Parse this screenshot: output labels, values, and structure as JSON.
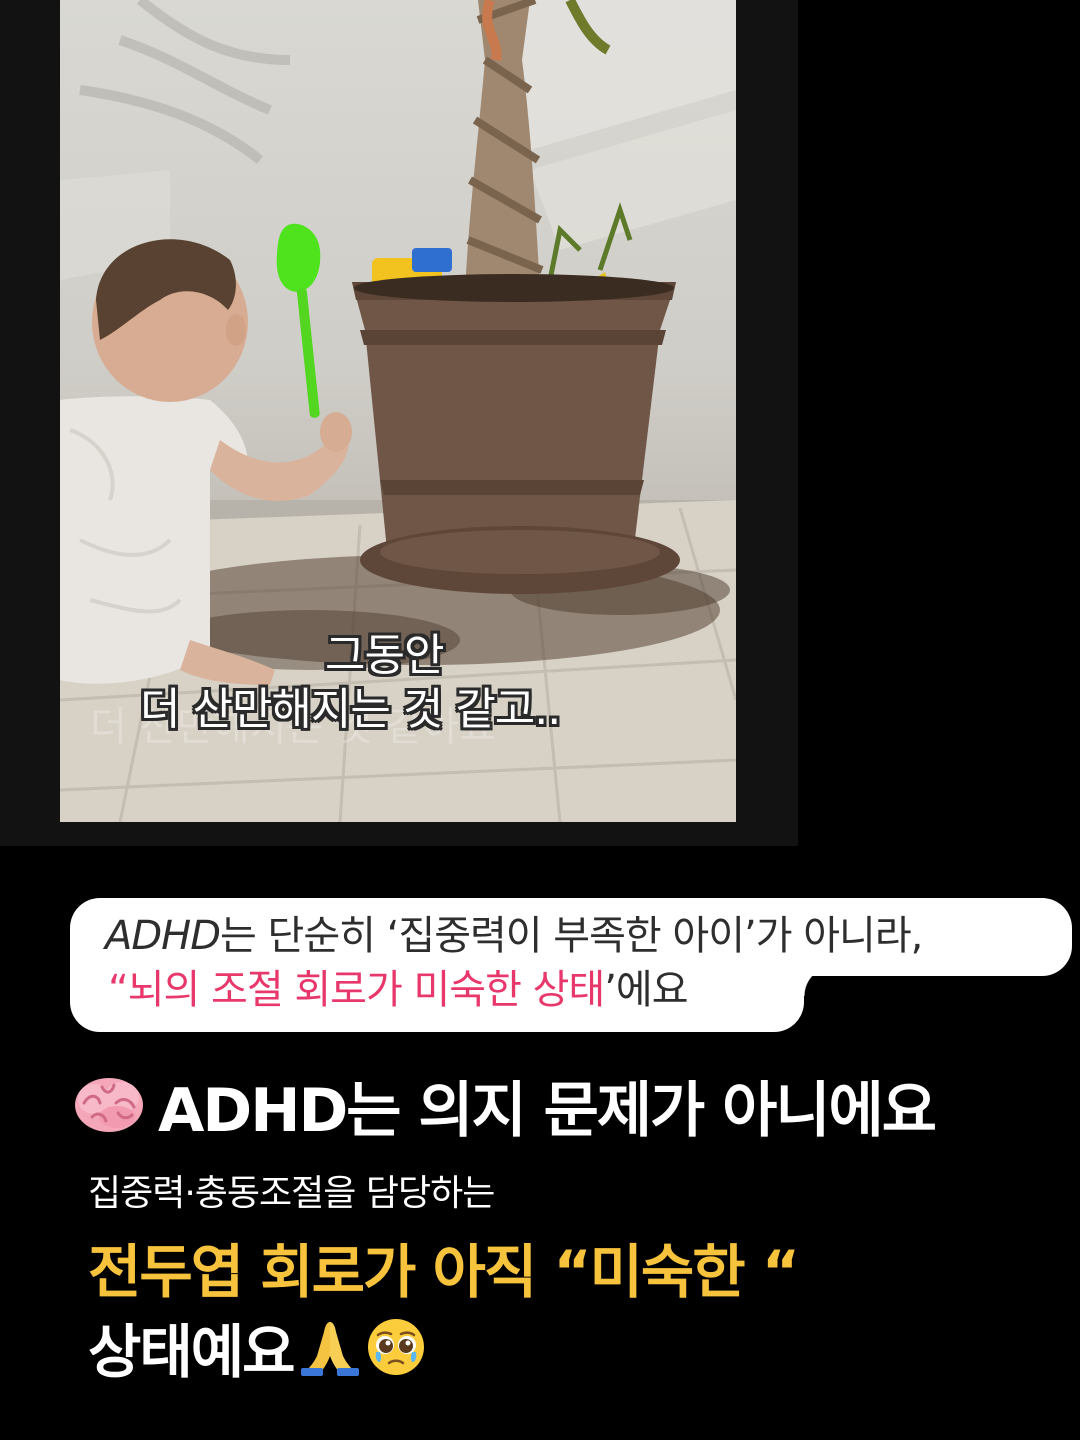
{
  "photo": {
    "subtitle_line1": "그동안",
    "subtitle_line2": "더 산만해지는 것 같고.."
  },
  "quote": {
    "line1_prefix": "ADHD",
    "line1_rest": "는 단순히 ‘집중력이 부족한 아이’가 아니라,",
    "line2_highlight": "“뇌의 조절 회로가 미숙한 상태",
    "line2_tail": "’에요",
    "accent_color": "#e8376b"
  },
  "caption": {
    "headline_icon": "brain-emoji",
    "headline": "ADHD는 의지 문제가 아니에요",
    "subline": "집중력·충동조절을 담당하는",
    "highlight": "전두엽 회로가 아직 “미숙한 “",
    "highlight_color": "#f7c23c",
    "final": "상태예요",
    "final_icons": [
      "folded-hands-emoji",
      "pleading-face-emoji"
    ]
  }
}
